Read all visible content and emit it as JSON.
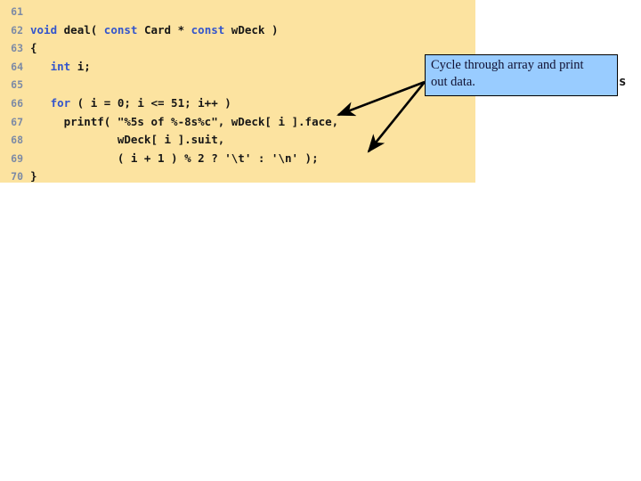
{
  "slide": {
    "background_color": "#ffffff",
    "code_panel": {
      "background_color": "#fce3a0",
      "line_number_color": "#7c8aa5",
      "keyword_color": "#3355cc",
      "text_color": "#161616",
      "lines": [
        {
          "number": "61",
          "segments": []
        },
        {
          "number": "62",
          "segments": [
            {
              "t": "void ",
              "kind": "keyword"
            },
            {
              "t": "deal( ",
              "kind": "plain"
            },
            {
              "t": "const ",
              "kind": "keyword"
            },
            {
              "t": "Card * ",
              "kind": "plain"
            },
            {
              "t": "const ",
              "kind": "keyword"
            },
            {
              "t": "wDeck )",
              "kind": "plain"
            }
          ]
        },
        {
          "number": "63",
          "segments": [
            {
              "t": "{",
              "kind": "plain"
            }
          ]
        },
        {
          "number": "64",
          "segments": [
            {
              "t": "   ",
              "kind": "plain"
            },
            {
              "t": "int ",
              "kind": "keyword"
            },
            {
              "t": "i;",
              "kind": "plain"
            }
          ]
        },
        {
          "number": "65",
          "segments": []
        },
        {
          "number": "66",
          "segments": [
            {
              "t": "   ",
              "kind": "plain"
            },
            {
              "t": "for",
              "kind": "keyword"
            },
            {
              "t": " ( i = 0; i <= 51; i++ )",
              "kind": "plain"
            }
          ]
        },
        {
          "number": "67",
          "segments": [
            {
              "t": "     printf( \"%5s of %-8s%c\", wDeck[ i ].face,",
              "kind": "plain"
            }
          ]
        },
        {
          "number": "68",
          "segments": [
            {
              "t": "             wDeck[ i ].suit,",
              "kind": "plain"
            }
          ]
        },
        {
          "number": "69",
          "segments": [
            {
              "t": "             ( i + 1 ) % 2 ? '\\t' : '\\n' );",
              "kind": "plain"
            }
          ]
        },
        {
          "number": "70",
          "segments": [
            {
              "t": "}",
              "kind": "plain"
            }
          ]
        }
      ]
    },
    "callout": {
      "text": "Cycle through array and print\nout data.",
      "fill_color": "#99ccff",
      "border_color": "#000000"
    },
    "stray_glyph": "s"
  }
}
